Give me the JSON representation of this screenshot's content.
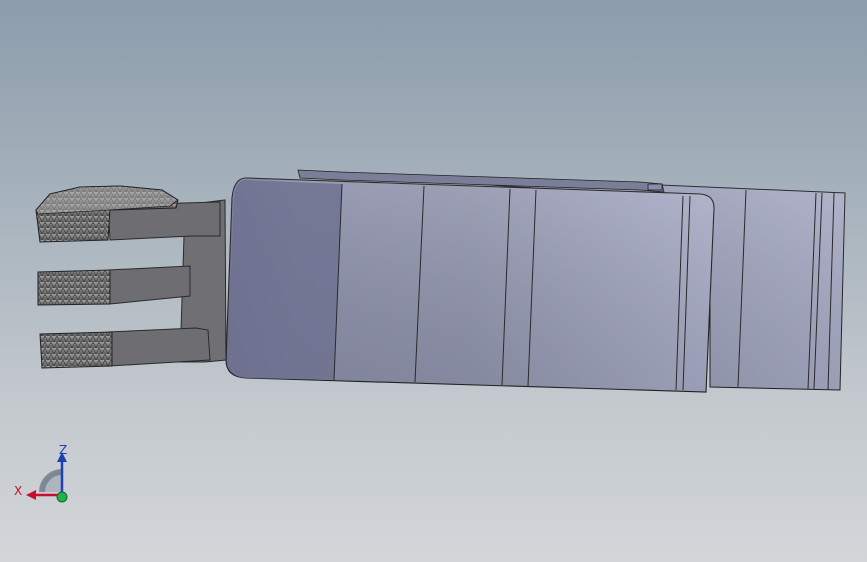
{
  "viewport": {
    "background_top": "#8c9cab",
    "background_bottom": "#d3d6d9"
  },
  "model": {
    "body_color": "#8a8ea5",
    "body_shadow": "#737790",
    "body_highlight": "#a4a8c2",
    "fingers_color": "#6f6f72",
    "knurl_color": "#8a8a8a"
  },
  "triad": {
    "x_label": "X",
    "z_label": "Z",
    "x_color": "#c8102e",
    "z_color": "#1f3fb5",
    "y_color": "#1fb34a"
  }
}
